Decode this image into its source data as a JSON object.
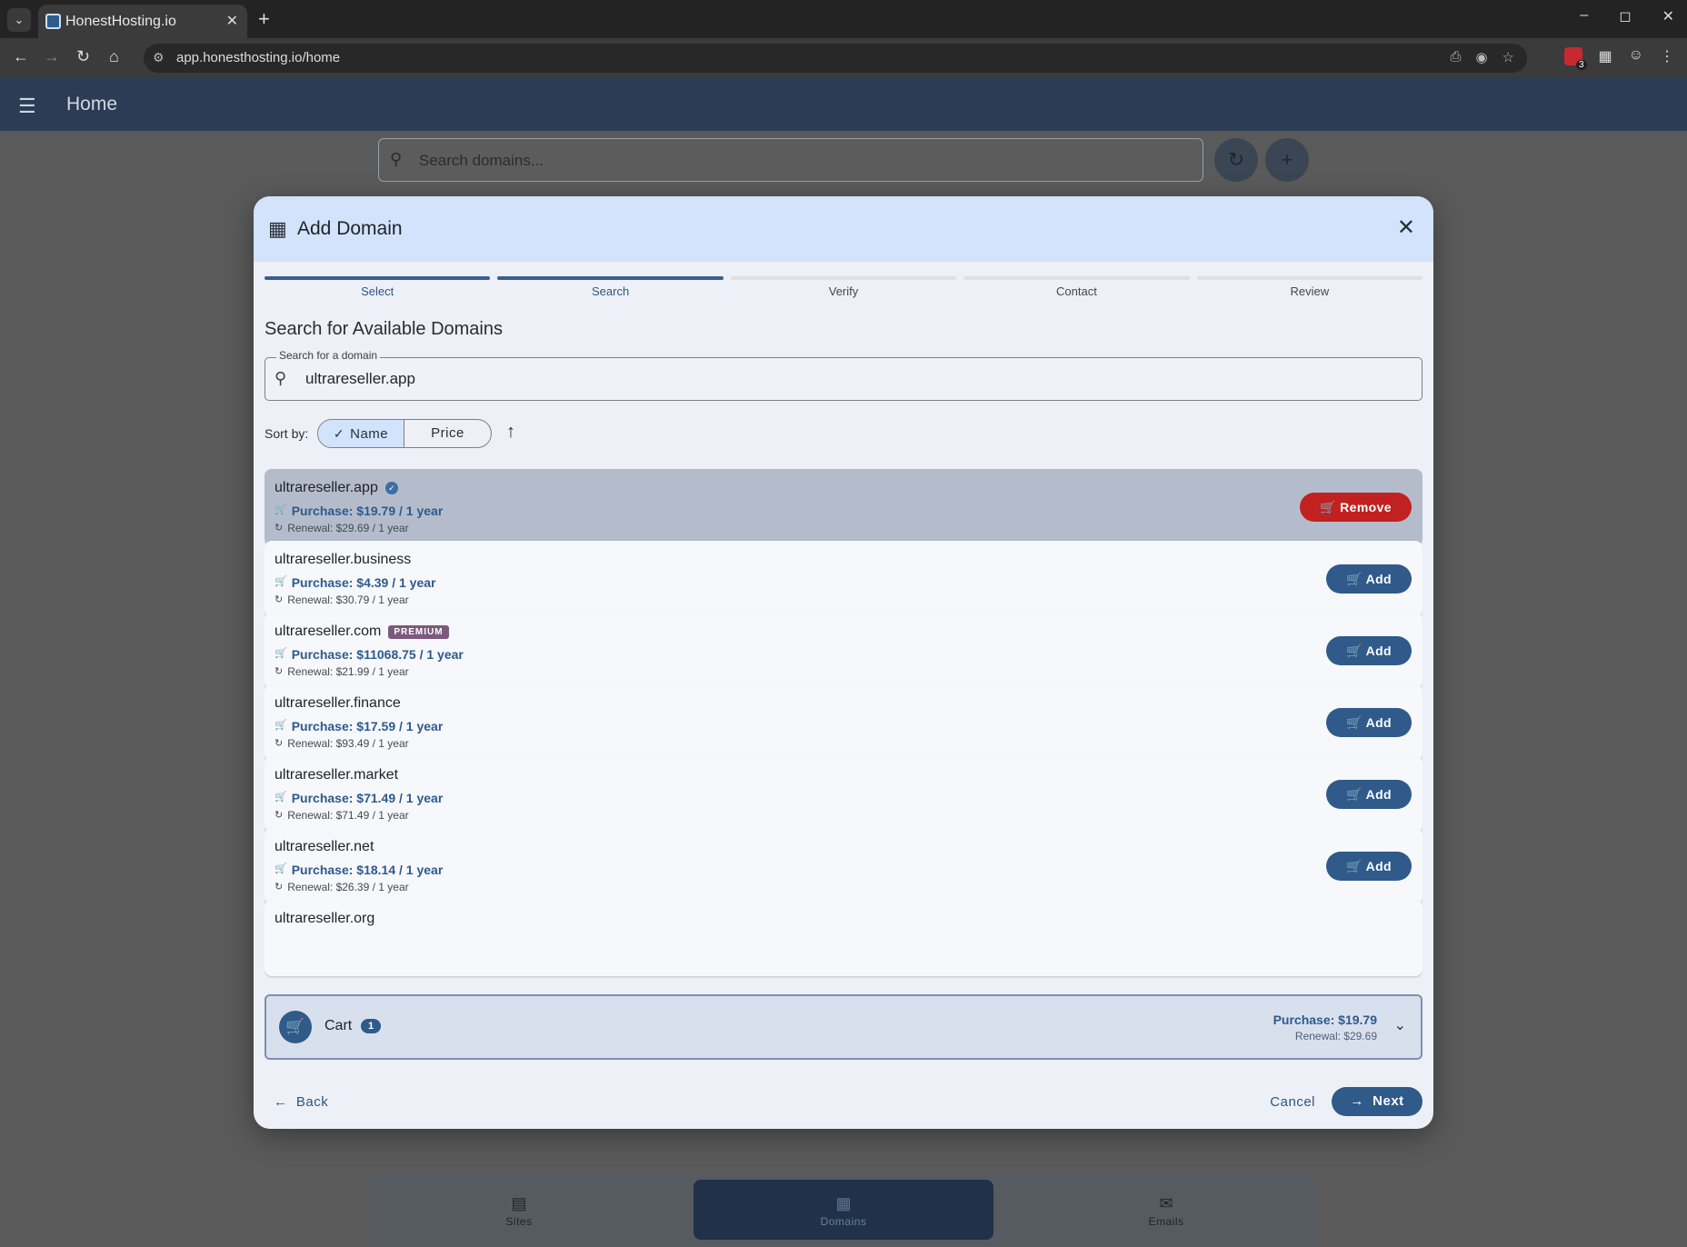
{
  "browser": {
    "tab_title": "HonestHosting.io",
    "url": "app.honesthosting.io/home",
    "extension_badge": "3"
  },
  "app": {
    "title": "Home",
    "search_placeholder": "Search domains...",
    "nav": [
      {
        "label": "Sites",
        "active": false
      },
      {
        "label": "Domains",
        "active": true
      },
      {
        "label": "Emails",
        "active": false
      }
    ]
  },
  "dialog": {
    "title": "Add Domain",
    "steps": [
      {
        "label": "Select",
        "done": true
      },
      {
        "label": "Search",
        "done": true
      },
      {
        "label": "Verify",
        "done": false
      },
      {
        "label": "Contact",
        "done": false
      },
      {
        "label": "Review",
        "done": false
      }
    ],
    "section_title": "Search for Available Domains",
    "search": {
      "label": "Search for a domain",
      "value": "ultrareseller.app"
    },
    "sort": {
      "label": "Sort by:",
      "options": [
        "Name",
        "Price"
      ],
      "selected": "Name"
    },
    "results": [
      {
        "name": "ultrareseller.app",
        "purchase": "Purchase: $19.79 / 1 year",
        "renewal": "Renewal: $29.69 / 1 year",
        "in_cart": true,
        "verified": true,
        "premium": false,
        "action": "Remove"
      },
      {
        "name": "ultrareseller.business",
        "purchase": "Purchase: $4.39 / 1 year",
        "renewal": "Renewal: $30.79 / 1 year",
        "in_cart": false,
        "verified": false,
        "premium": false,
        "action": "Add"
      },
      {
        "name": "ultrareseller.com",
        "purchase": "Purchase: $11068.75 / 1 year",
        "renewal": "Renewal: $21.99 / 1 year",
        "in_cart": false,
        "verified": false,
        "premium": true,
        "action": "Add"
      },
      {
        "name": "ultrareseller.finance",
        "purchase": "Purchase: $17.59 / 1 year",
        "renewal": "Renewal: $93.49 / 1 year",
        "in_cart": false,
        "verified": false,
        "premium": false,
        "action": "Add"
      },
      {
        "name": "ultrareseller.market",
        "purchase": "Purchase: $71.49 / 1 year",
        "renewal": "Renewal: $71.49 / 1 year",
        "in_cart": false,
        "verified": false,
        "premium": false,
        "action": "Add"
      },
      {
        "name": "ultrareseller.net",
        "purchase": "Purchase: $18.14 / 1 year",
        "renewal": "Renewal: $26.39 / 1 year",
        "in_cart": false,
        "verified": false,
        "premium": false,
        "action": "Add"
      },
      {
        "name": "ultrareseller.org",
        "purchase": "",
        "renewal": "",
        "in_cart": false,
        "verified": false,
        "premium": false,
        "action": ""
      }
    ],
    "premium_label": "PREMIUM",
    "cart": {
      "label": "Cart",
      "count": "1",
      "purchase": "Purchase: $19.79",
      "renewal": "Renewal: $29.69"
    },
    "back_label": "Back",
    "cancel_label": "Cancel",
    "next_label": "Next"
  },
  "colors": {
    "primary": "#2f5a8a",
    "danger": "#c12121",
    "dialog_header": "#d3e3fb",
    "premium": "#7b5a7d"
  }
}
